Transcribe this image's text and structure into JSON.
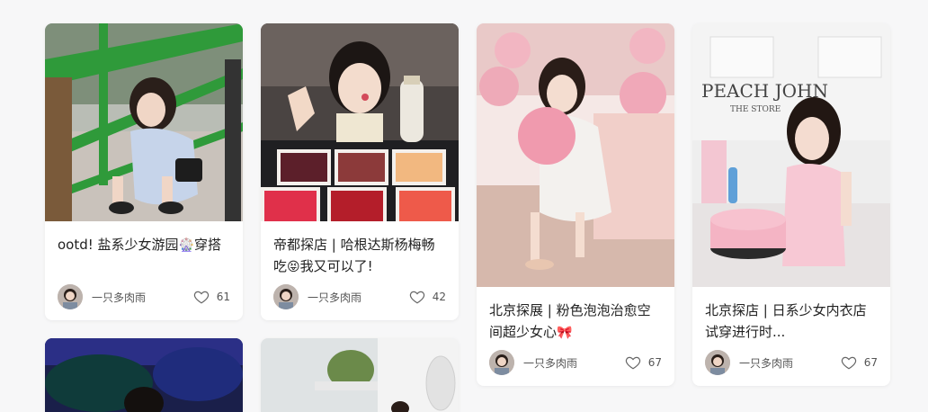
{
  "colors": {
    "background": "#f7f7f8",
    "card": "#ffffff",
    "text": "#222222",
    "muted": "#555555"
  },
  "cards": [
    {
      "title": "ootd! 盐系少女游园",
      "title_emoji": "🎡",
      "title_tail": "穿搭",
      "author": "一只多肉雨",
      "likes": "61",
      "icon": "heart-outline-icon"
    },
    {
      "title": "帝都探店 | 哈根达斯杨梅畅吃",
      "title_emoji": "😝",
      "title_tail": "我又可以了!",
      "author": "一只多肉雨",
      "likes": "42",
      "icon": "heart-outline-icon"
    },
    {
      "title": "北京探展 | 粉色泡泡治愈空间超少女心",
      "title_emoji": "🎀",
      "title_tail": "",
      "author": "一只多肉雨",
      "likes": "67",
      "icon": "heart-outline-icon"
    },
    {
      "title": "北京探店 | 日系少女内衣店试穿进行时...",
      "title_emoji": "",
      "title_tail": "",
      "author": "一只多肉雨",
      "likes": "67",
      "icon": "heart-outline-icon"
    }
  ],
  "photo_text": {
    "store_sign": "PEACH JOHN",
    "store_sub": "THE STORE"
  }
}
